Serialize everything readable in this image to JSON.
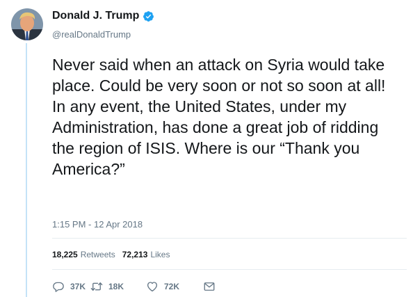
{
  "author": {
    "display_name": "Donald J. Trump",
    "handle": "@realDonaldTrump",
    "verified": true
  },
  "tweet": {
    "text": "Never said when an attack on Syria would take place. Could be very soon or not so soon at all! In any event, the United States, under my Administration, has done a great job of ridding the region of ISIS. Where is our “Thank you America?”",
    "timestamp": "1:15 PM - 12 Apr 2018"
  },
  "stats": {
    "retweets_count": "18,225",
    "retweets_label": "Retweets",
    "likes_count": "72,213",
    "likes_label": "Likes"
  },
  "actions": {
    "reply_count": "37K",
    "retweet_count": "18K",
    "like_count": "72K"
  },
  "icons": {
    "reply": "reply-icon",
    "retweet": "retweet-icon",
    "like": "heart-icon",
    "dm": "envelope-icon",
    "verified": "verified-badge-icon"
  },
  "colors": {
    "accent": "#1da1f2",
    "thread_line": "#c4e3f7",
    "muted_text": "#657786"
  }
}
